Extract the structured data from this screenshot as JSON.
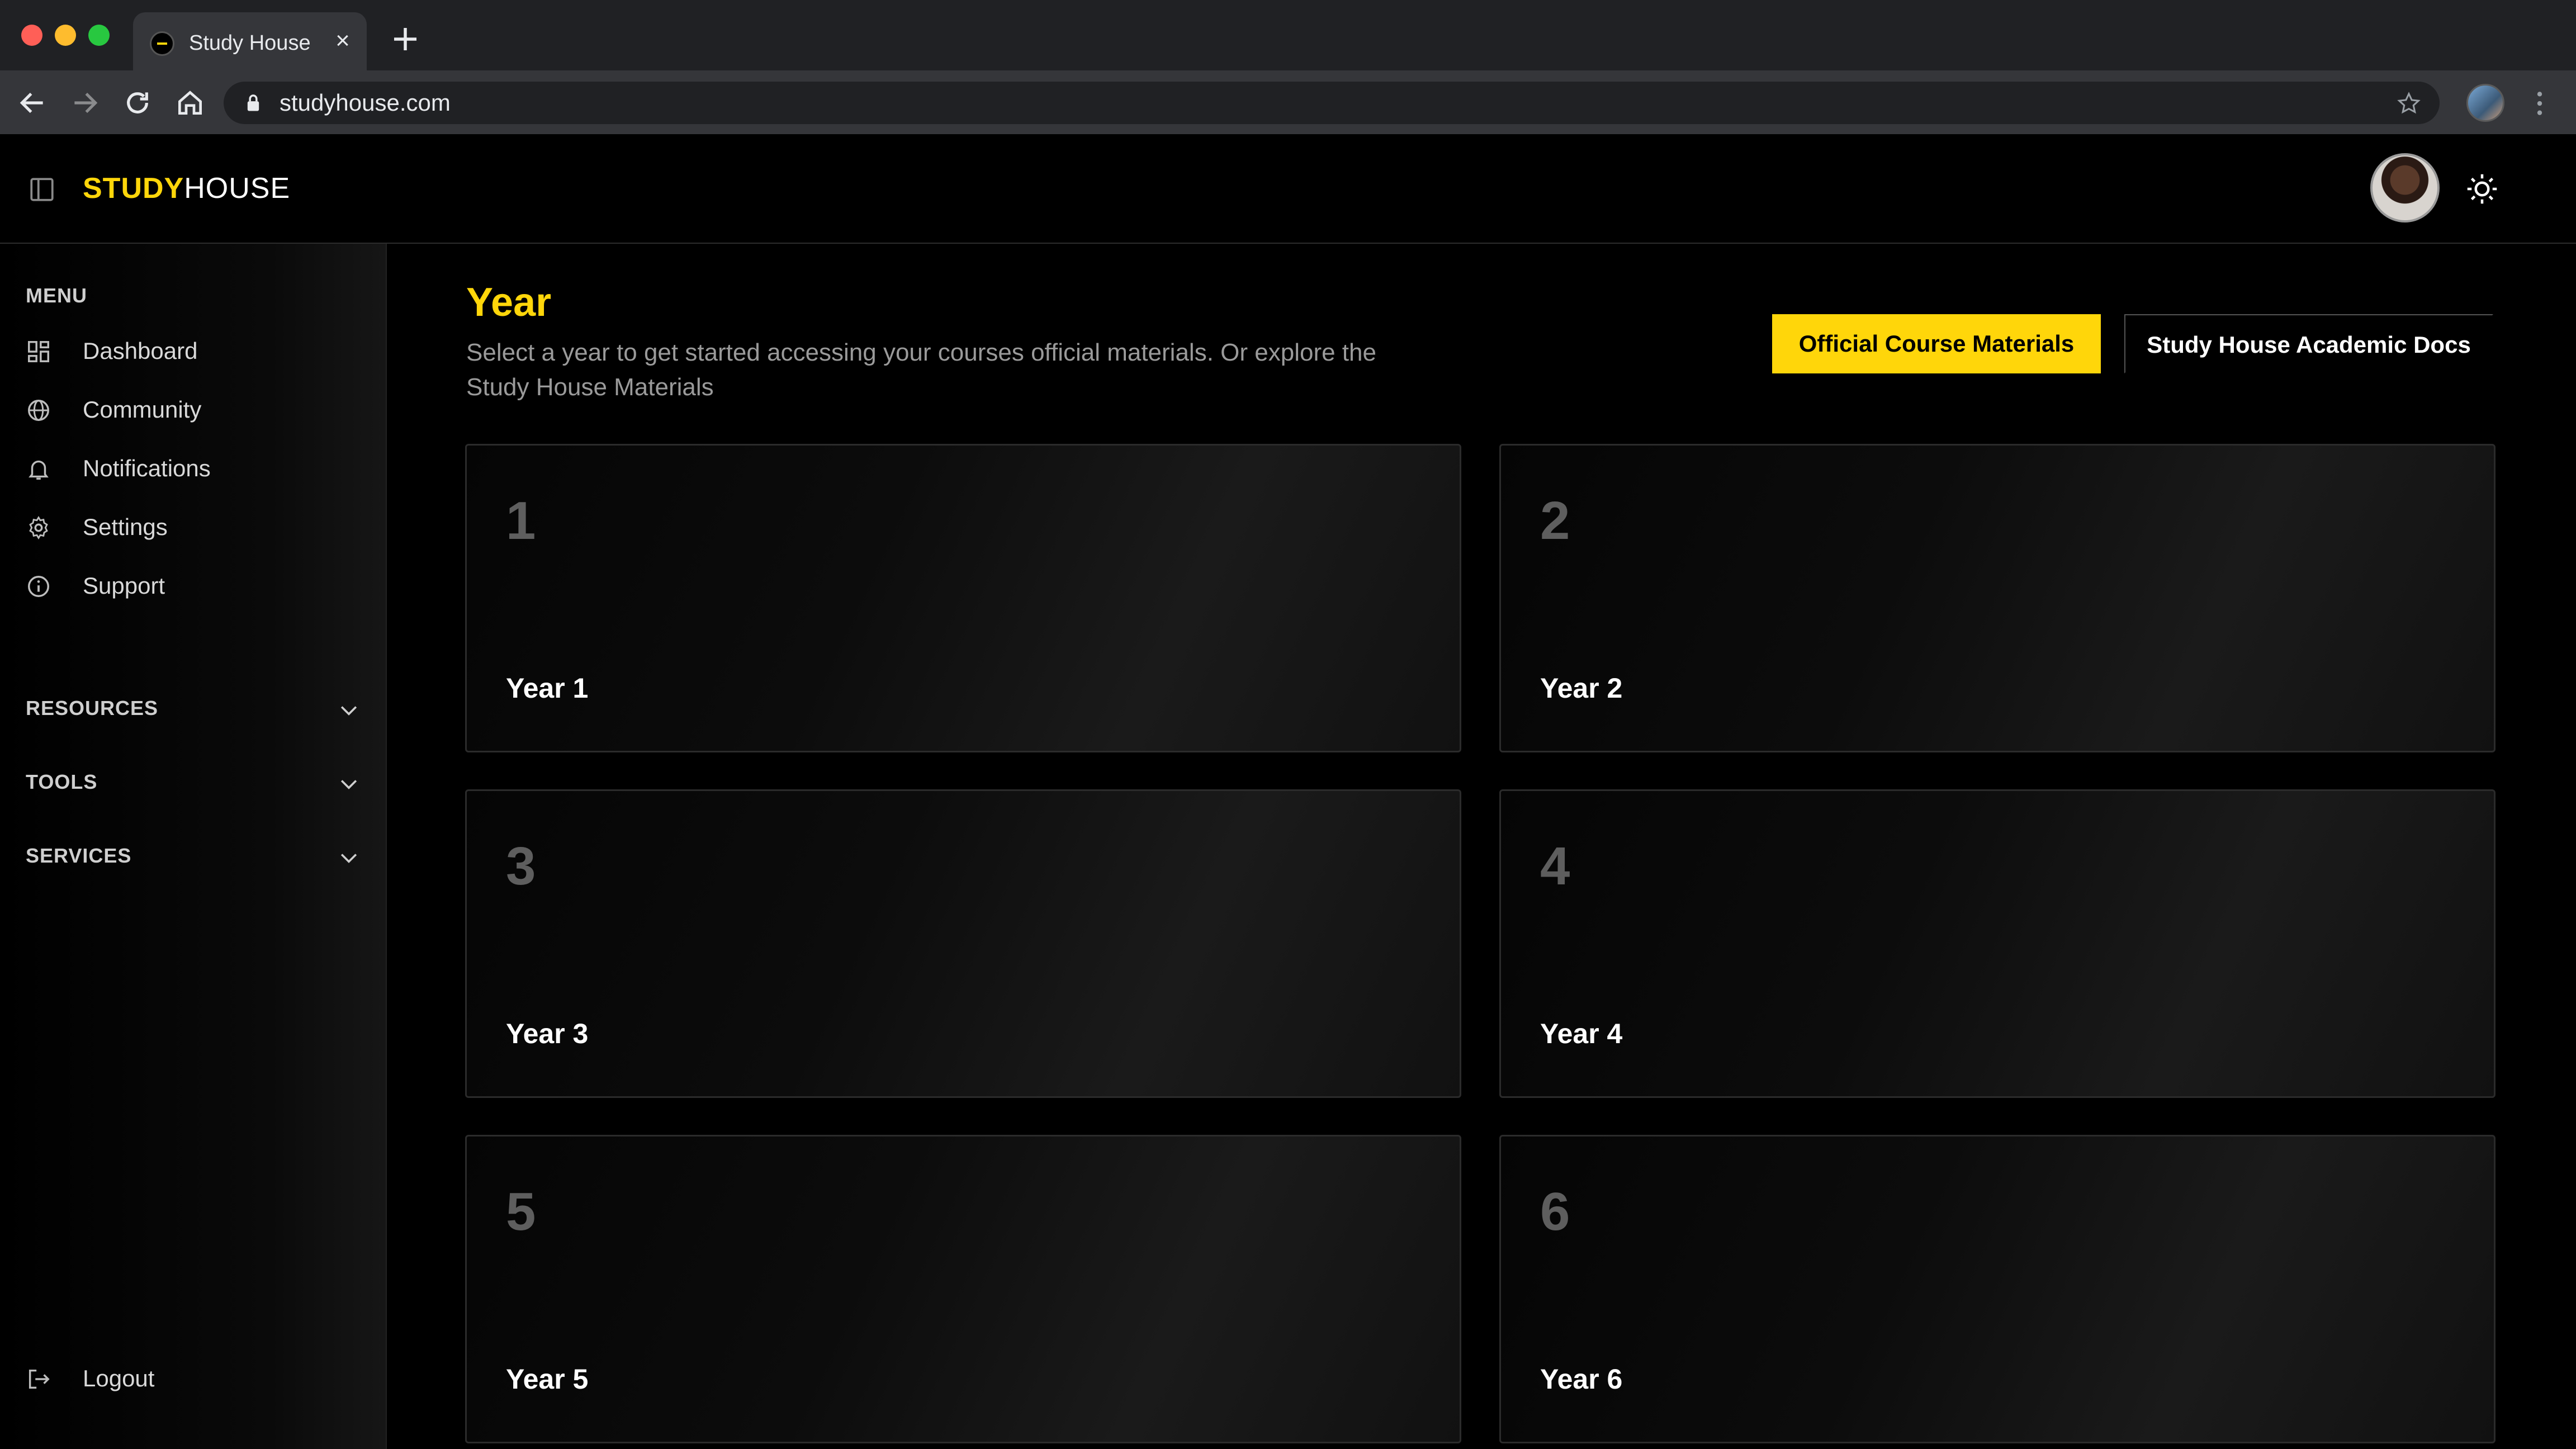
{
  "browser": {
    "tab_title": "Study House",
    "tab_close_glyph": "×",
    "url": "studyhouse.com",
    "icons": [
      "back-icon",
      "forward-icon",
      "reload-icon",
      "home-icon",
      "lock-icon",
      "star-icon",
      "kebab-menu-icon"
    ]
  },
  "header": {
    "logo_bold": "STUDY",
    "logo_regular": "HOUSE",
    "brand_color": "#ffd60a"
  },
  "sidebar": {
    "menu_title": "MENU",
    "items": [
      {
        "label": "Dashboard",
        "icon": "dashboard-icon"
      },
      {
        "label": "Community",
        "icon": "globe-icon"
      },
      {
        "label": "Notifications",
        "icon": "bell-icon"
      },
      {
        "label": "Settings",
        "icon": "gear-icon"
      },
      {
        "label": "Support",
        "icon": "info-icon"
      }
    ],
    "sections": [
      {
        "label": "RESOURCES"
      },
      {
        "label": "TOOLS"
      },
      {
        "label": "SERVICES"
      }
    ],
    "logout_label": "Logout"
  },
  "main": {
    "title": "Year",
    "description": "Select a year to get started accessing your courses official materials. Or explore the Study House Materials",
    "buttons": {
      "primary": "Official Course Materials",
      "secondary": "Study House Academic Docs"
    },
    "cards": [
      {
        "number": "1",
        "label": "Year 1"
      },
      {
        "number": "2",
        "label": "Year 2"
      },
      {
        "number": "3",
        "label": "Year 3"
      },
      {
        "number": "4",
        "label": "Year 4"
      },
      {
        "number": "5",
        "label": "Year 5"
      },
      {
        "number": "6",
        "label": "Year 6"
      }
    ]
  }
}
